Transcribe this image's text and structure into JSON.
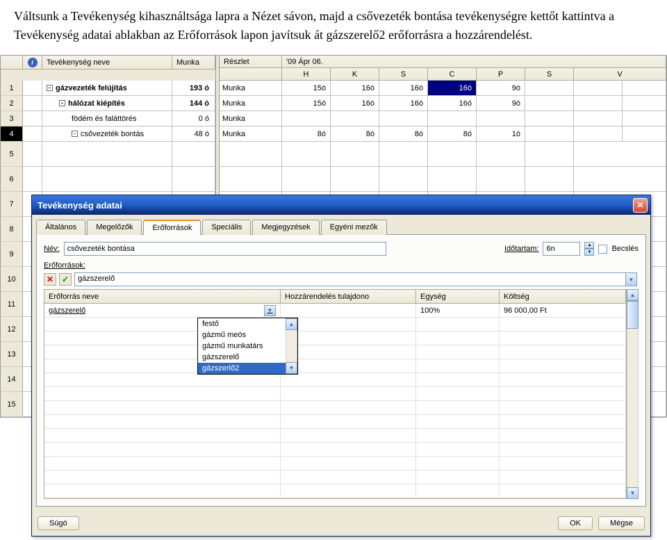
{
  "doc": {
    "paragraph": "Váltsunk a Tevékenység kihasználtsága lapra a Nézet sávon, majd a csővezeték bontása tevékenységre kettőt kattintva a Tevékenység adatai ablakban az Erőforrások lapon javítsuk át gázszerelő2 erőforrásra a hozzárendelést."
  },
  "grid": {
    "headers": {
      "info": "",
      "task": "Tevékenység neve",
      "work": "Munka",
      "detail": "Részlet",
      "week": "'09 Ápr 06.",
      "days": [
        "H",
        "K",
        "S",
        "C",
        "P",
        "S",
        "V"
      ]
    },
    "rows": [
      {
        "n": "1",
        "name": "gázvezeték felújítás",
        "bold": true,
        "tree": "-",
        "indent": 0,
        "work": "193 ó",
        "detail": "Munka",
        "days": [
          "15ó",
          "16ó",
          "16ó",
          "16ó",
          "9ó",
          "",
          ""
        ],
        "sel": [
          false,
          false,
          false,
          true,
          false,
          false,
          false
        ]
      },
      {
        "n": "2",
        "name": "hálózat kiépítés",
        "bold": true,
        "tree": "-",
        "indent": 1,
        "work": "144 ó",
        "detail": "Munka",
        "days": [
          "15ó",
          "16ó",
          "16ó",
          "16ó",
          "9ó",
          "",
          ""
        ]
      },
      {
        "n": "3",
        "name": "födém és faláttörés",
        "bold": false,
        "indent": 2,
        "work": "0 ó",
        "detail": "Munka",
        "days": [
          "",
          "",
          "",
          "",
          "",
          "",
          ""
        ]
      },
      {
        "n": "4",
        "name": "csővezeték bontás",
        "bold": false,
        "tree": "-",
        "indent": 2,
        "work": "48 ó",
        "detail": "Munka",
        "days": [
          "8ó",
          "8ó",
          "8ó",
          "8ó",
          "1ó",
          "",
          ""
        ],
        "rowsel": true
      }
    ],
    "empty_rows": [
      "5",
      "6",
      "7",
      "8",
      "9",
      "10",
      "11",
      "12",
      "13",
      "14",
      "15"
    ]
  },
  "dialog": {
    "title": "Tevékenység adatai",
    "tabs": [
      "Általános",
      "Megelőzők",
      "Erőforrások",
      "Speciális",
      "Megjegyzések",
      "Egyéni mezők"
    ],
    "active_tab": 2,
    "name_label": "Név:",
    "name_value": "csővezeték bontása",
    "duration_label": "Időtartam:",
    "duration_value": "6n",
    "estimate_label": "Becslés",
    "resources_label": "Erőforrások:",
    "combo_value": "gázszerelő",
    "res_headers": [
      "Erőforrás neve",
      "Hozzárendelés tulajdono",
      "Egység",
      "Költség"
    ],
    "res_row": {
      "name": "gázszerelő",
      "owner": "",
      "unit": "100%",
      "cost": "96 000,00 Ft"
    },
    "dropdown": [
      "festő",
      "gázmű meós",
      "gázmű munkatárs",
      "gázszerelő",
      "gázszerlő2"
    ],
    "dd_selected": 4,
    "buttons": {
      "help": "Súgó",
      "ok": "OK",
      "cancel": "Mégse"
    }
  }
}
